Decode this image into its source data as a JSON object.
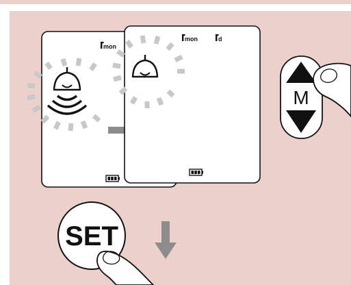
{
  "colors": {
    "background": "#ffffff",
    "panel": "#ecd0cc",
    "strip": "#ecd0cc",
    "screen": "#ffffff",
    "ink": "#111111",
    "flash": "#c8c8c8",
    "arrow": "#8c8c8c"
  },
  "screen_left": {
    "indicator_mon": "mon",
    "icon": "alarm-ringing-bell-icon",
    "battery_icon": "battery-icon"
  },
  "screen_right": {
    "indicator_mon": "mon",
    "indicator_d": "d",
    "icon": "alarm-bell-icon",
    "battery_icon": "battery-icon"
  },
  "mode_button": {
    "label": "M",
    "up_icon": "triangle-up-icon",
    "down_icon": "triangle-down-icon"
  },
  "set_button": {
    "label": "SET"
  },
  "transition_arrow": "arrow-right-icon",
  "press_arrow": "arrow-down-icon"
}
